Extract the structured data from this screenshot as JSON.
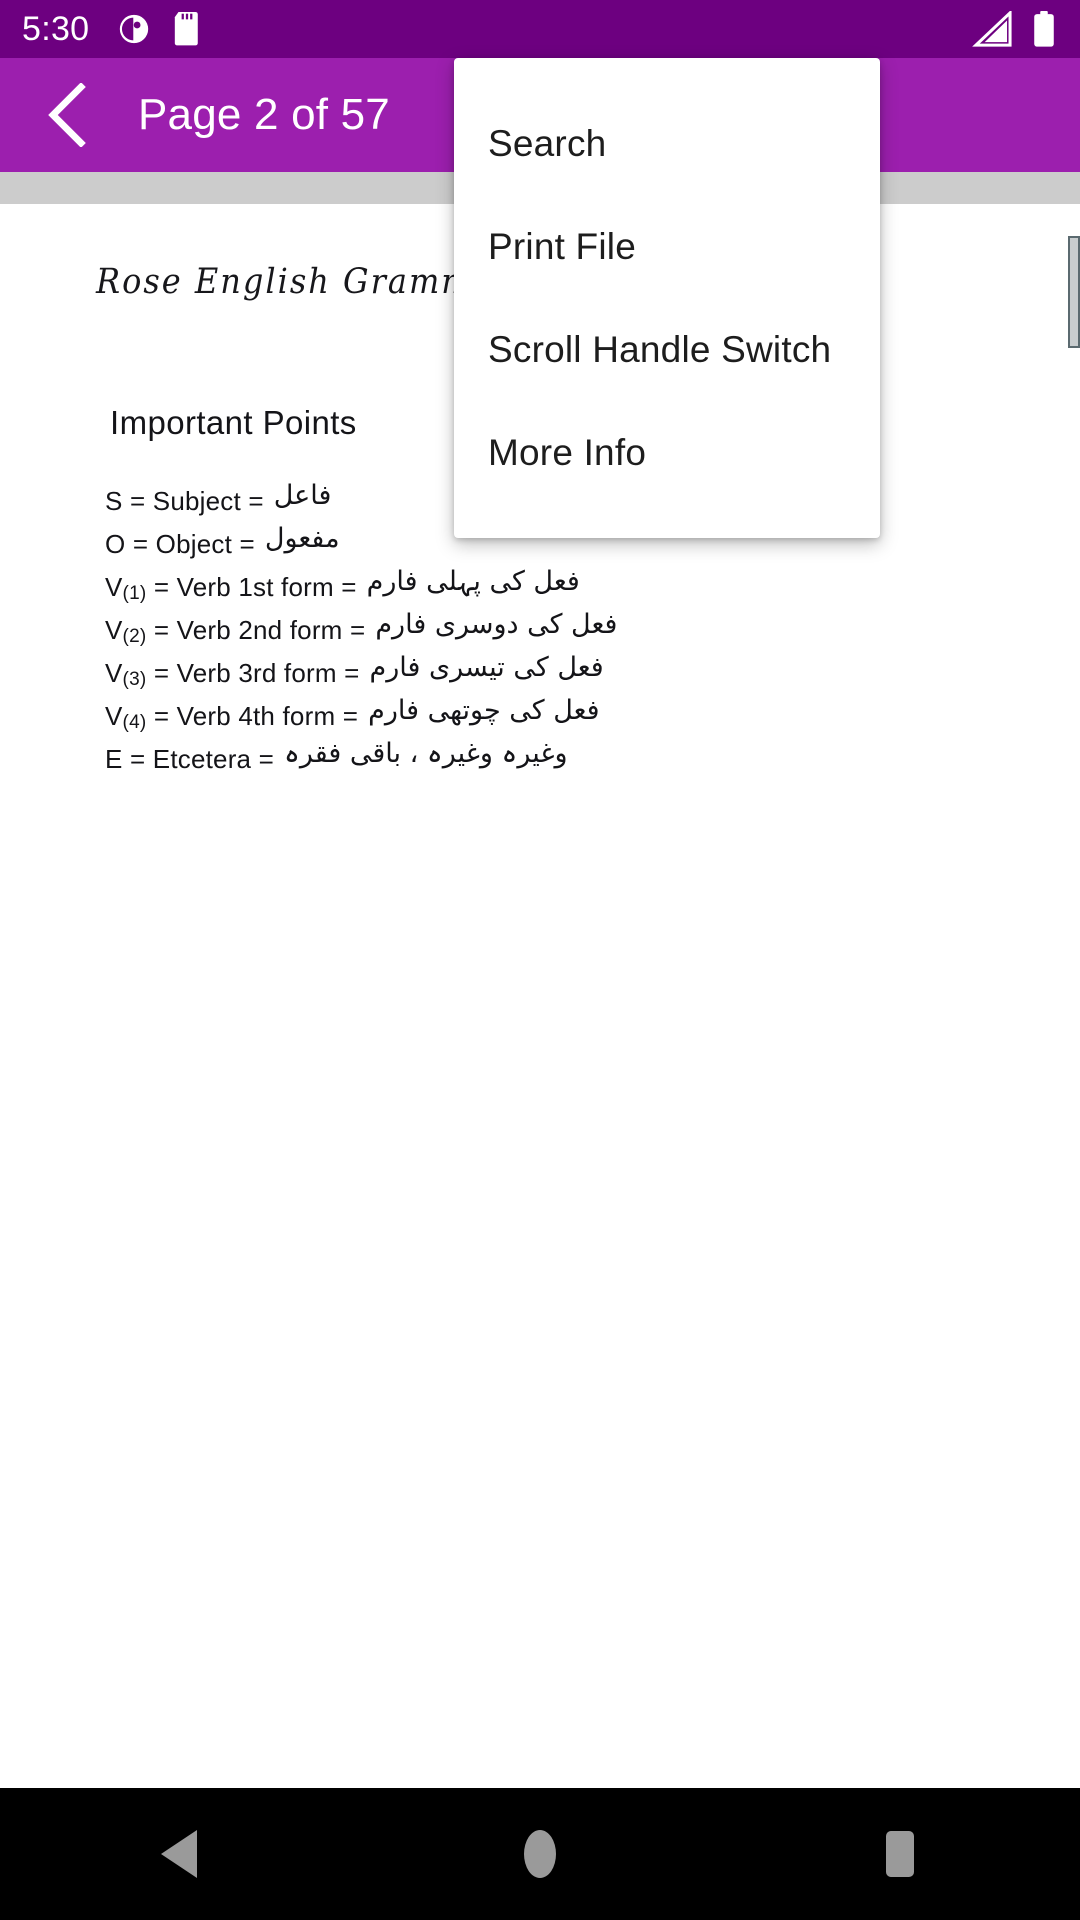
{
  "status_bar": {
    "time": "5:30",
    "background": "#6d0080",
    "icons": [
      "notification-dot-icon",
      "sd-card-icon",
      "cellular-signal-icon",
      "battery-full-icon"
    ]
  },
  "app_bar": {
    "background": "#9c1fae",
    "back_icon": "chevron-left-icon",
    "title": "Page 2 of 57",
    "current_page": 2,
    "total_pages": 57
  },
  "popup_menu": {
    "items": [
      {
        "label": "Search"
      },
      {
        "label": "Print File"
      },
      {
        "label": "Scroll Handle Switch"
      },
      {
        "label": "More Info"
      }
    ]
  },
  "document": {
    "title": "Rose English Grammar",
    "heading": "Important Points",
    "lines": [
      {
        "symbol": "S",
        "sub": "",
        "english": "= Subject =",
        "urdu": "فاعل"
      },
      {
        "symbol": "O",
        "sub": "",
        "english": "= Object =",
        "urdu": "مفعول"
      },
      {
        "symbol": "V",
        "sub": "(1)",
        "english": "= Verb 1st form =",
        "urdu": "فعل کی پہلی فارم"
      },
      {
        "symbol": "V",
        "sub": "(2)",
        "english": "= Verb 2nd form =",
        "urdu": "فعل کی دوسری فارم"
      },
      {
        "symbol": "V",
        "sub": "(3)",
        "english": "= Verb 3rd form =",
        "urdu": "فعل کی تیسری فارم"
      },
      {
        "symbol": "V",
        "sub": "(4)",
        "english": "= Verb 4th form =",
        "urdu": "فعل کی چوتھی فارم"
      },
      {
        "symbol": "E",
        "sub": "",
        "english": "= Etcetera =",
        "urdu": "وغیرہ وغیرہ ، باقی فقرہ"
      }
    ]
  },
  "nav_bar": {
    "background": "#000000",
    "buttons": [
      "back-triangle-icon",
      "home-circle-icon",
      "recents-square-icon"
    ]
  }
}
